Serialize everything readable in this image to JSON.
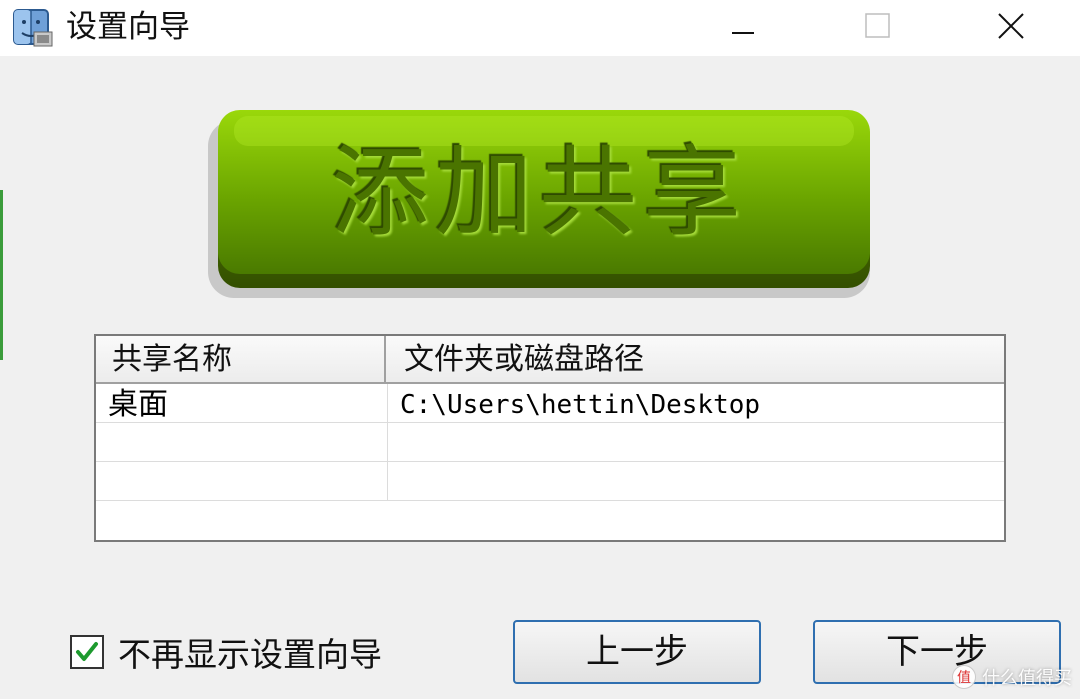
{
  "window": {
    "title": "设置向导",
    "icon": "app-finder-icon",
    "controls": [
      "minimize-icon",
      "maximize-icon",
      "close-icon"
    ]
  },
  "banner": {
    "text": "添加共享",
    "color": "#7db800"
  },
  "share_table": {
    "columns": [
      "共享名称",
      "文件夹或磁盘路径"
    ],
    "rows": [
      {
        "name": "桌面",
        "path": "C:\\Users\\hettin\\Desktop"
      },
      {
        "name": "",
        "path": ""
      },
      {
        "name": "",
        "path": ""
      }
    ]
  },
  "options": {
    "dont_show_wizard_label": "不再显示设置向导",
    "dont_show_wizard_checked": true
  },
  "buttons": {
    "prev_label": "上一步",
    "next_label": "下一步"
  },
  "watermark": {
    "text": "什么值得买"
  }
}
